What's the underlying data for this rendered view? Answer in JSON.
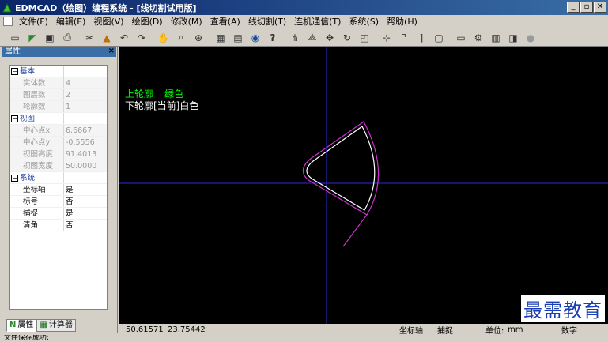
{
  "window": {
    "title": "EDMCAD（绘图）编程系统 - [线切割试用版]",
    "buttons": {
      "minimize": "_",
      "restore": "▫",
      "close": "✕"
    }
  },
  "menu": {
    "items": [
      "文件(F)",
      "编辑(E)",
      "视图(V)",
      "绘图(D)",
      "修改(M)",
      "查看(A)",
      "线切割(T)",
      "连机通信(T)",
      "系统(S)",
      "帮助(H)"
    ]
  },
  "toolbar": {
    "icons": [
      "new-icon",
      "open-icon",
      "save-icon",
      "print-icon",
      "cut-icon",
      "paint-icon",
      "undo-icon",
      "redo-icon",
      "pan-icon",
      "zoom-window-icon",
      "zoom-icon",
      "grid-icon",
      "calculator-icon",
      "zoom-fit-icon",
      "help-icon",
      "mirror-icon",
      "array-icon",
      "move-icon",
      "rotate-icon",
      "scale-icon",
      "line-icon",
      "corner-icon",
      "arc-corner-icon",
      "rect-icon",
      "window-icon",
      "settings-icon",
      "wire-icon",
      "export-icon",
      "exit-icon"
    ]
  },
  "panel": {
    "title": "属性",
    "close": "×",
    "rows": [
      {
        "type": "cat",
        "key": "基本",
        "value": ""
      },
      {
        "type": "gray",
        "key": "实体数",
        "value": "4"
      },
      {
        "type": "gray",
        "key": "图层数",
        "value": "2"
      },
      {
        "type": "gray",
        "key": "轮廓数",
        "value": "1"
      },
      {
        "type": "cat",
        "key": "视图",
        "value": ""
      },
      {
        "type": "gray",
        "key": "中心点x",
        "value": "6.6667"
      },
      {
        "type": "gray",
        "key": "中心点y",
        "value": "-0.5556"
      },
      {
        "type": "gray",
        "key": "视图高度",
        "value": "91.4013"
      },
      {
        "type": "gray",
        "key": "视图宽度",
        "value": "50.0000"
      },
      {
        "type": "cat",
        "key": "系统",
        "value": ""
      },
      {
        "type": "normal",
        "key": "坐标轴",
        "value": "是"
      },
      {
        "type": "normal",
        "key": "标号",
        "value": "否"
      },
      {
        "type": "normal",
        "key": "捕捉",
        "value": "是"
      },
      {
        "type": "normal",
        "key": "清角",
        "value": "否"
      }
    ],
    "tabs": {
      "properties": "属性",
      "calculator": "计算器"
    }
  },
  "canvas": {
    "upper_label": "上轮廓",
    "upper_color": "绿色",
    "lower_label": "下轮廓[当前]白色",
    "watermark": "最需教育",
    "colors": {
      "background": "#000000",
      "axis": "#2b2bdb",
      "upper": "#cc33cc",
      "lower": "#ffffff",
      "label_upper": "#00ff00"
    }
  },
  "status": {
    "x": "50.61571",
    "y": "23.75442",
    "axis": "坐标轴",
    "snap": "捕捉",
    "unit_label": "单位:",
    "unit_value": "mm",
    "mm_label": "数字"
  },
  "bottom": {
    "text": " 文件保存成功:"
  }
}
